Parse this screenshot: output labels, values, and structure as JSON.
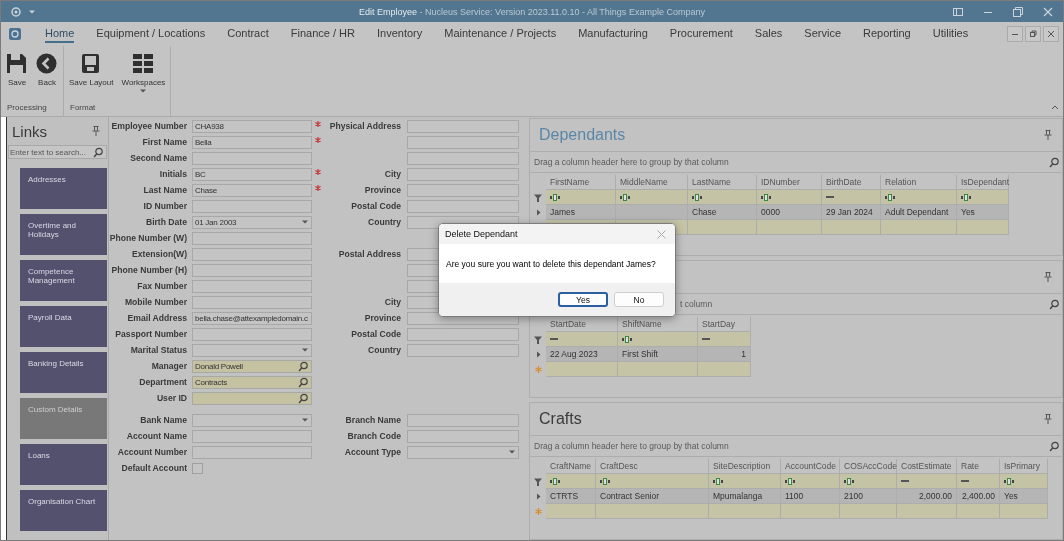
{
  "window": {
    "title": "**Edit Employee** - Nucleus Service: Version 2023.11.0.10 - All Things Example Company"
  },
  "menu": [
    {
      "label": "Home",
      "selected": true
    },
    {
      "label": "Equipment / Locations",
      "selected": false
    },
    {
      "label": "Contract",
      "selected": false
    },
    {
      "label": "Finance / HR",
      "selected": false
    },
    {
      "label": "Inventory",
      "selected": false
    },
    {
      "label": "Maintenance / Projects",
      "selected": false
    },
    {
      "label": "Manufacturing",
      "selected": false
    },
    {
      "label": "Procurement",
      "selected": false
    },
    {
      "label": "Sales",
      "selected": false
    },
    {
      "label": "Service",
      "selected": false
    },
    {
      "label": "Reporting",
      "selected": false
    },
    {
      "label": "Utilities",
      "selected": false
    }
  ],
  "ribbon": [
    {
      "label": "Processing",
      "buttons": [
        {
          "label": "Save"
        },
        {
          "label": "Back"
        }
      ]
    },
    {
      "label": "Format",
      "buttons": [
        {
          "label": "Save Layout"
        },
        {
          "label": "Workspaces",
          "dropdown": true
        }
      ]
    }
  ],
  "links": {
    "title": "Links",
    "search": {
      "placeholder": "Enter text to search..."
    },
    "items": [
      {
        "label": "Addresses",
        "disabled": false
      },
      {
        "label": "Overtime and Holidays",
        "disabled": false
      },
      {
        "label": "Competence Management",
        "disabled": false
      },
      {
        "label": "Payroll Data",
        "disabled": false
      },
      {
        "label": "Banking Details",
        "disabled": false
      },
      {
        "label": "Custom Details",
        "disabled": true
      },
      {
        "label": "Loans",
        "disabled": false
      },
      {
        "label": "Organisation Chart",
        "disabled": false
      }
    ]
  },
  "form": {
    "personal": [
      {
        "label": "Employee Number",
        "kind": "text",
        "value": "CHA938",
        "required": true
      },
      {
        "label": "First Name",
        "kind": "text",
        "value": "Bella",
        "required": true
      },
      {
        "label": "Second Name",
        "kind": "text",
        "required": false
      },
      {
        "label": "Initials",
        "kind": "text",
        "value": "BC",
        "required": true
      },
      {
        "label": "Last Name",
        "kind": "text",
        "value": "Chase",
        "required": true
      },
      {
        "label": "ID Number",
        "kind": "text",
        "required": false
      },
      {
        "label": "Birth Date",
        "kind": "dropdown",
        "value": "01 Jan 2003",
        "required": false
      },
      {
        "label": "Phone Number (W)",
        "kind": "text",
        "required": false
      },
      {
        "label": "Extension(W)",
        "kind": "text",
        "required": false
      },
      {
        "label": "Phone Number (H)",
        "kind": "text",
        "required": false
      },
      {
        "label": "Fax Number",
        "kind": "text",
        "required": false
      },
      {
        "label": "Mobile Number",
        "kind": "text",
        "required": false
      },
      {
        "label": "Email Address",
        "kind": "text",
        "value": "bella.chase@attexampledomain.c",
        "required": false
      },
      {
        "label": "Passport Number",
        "kind": "text",
        "required": false
      },
      {
        "label": "Marital Status",
        "kind": "dropdown",
        "required": false
      },
      {
        "label": "Manager",
        "kind": "lookup",
        "value": "Donald Powell",
        "required": false
      },
      {
        "label": "Department",
        "kind": "lookup",
        "value": "Contracts",
        "required": false
      },
      {
        "label": "User ID",
        "kind": "lookup",
        "required": false
      }
    ],
    "physical_address": [
      {
        "label": "Physical Address",
        "kind": "text"
      },
      {
        "kind": "text"
      },
      {
        "kind": "text"
      },
      {
        "label": "City",
        "kind": "text"
      },
      {
        "label": "Province",
        "kind": "text"
      },
      {
        "label": "Postal Code",
        "kind": "text"
      },
      {
        "label": "Country",
        "kind": "text"
      }
    ],
    "postal_address": [
      {
        "label": "Postal Address",
        "kind": "text"
      },
      {
        "kind": "text"
      },
      {
        "kind": "text"
      },
      {
        "label": "City",
        "kind": "text"
      },
      {
        "label": "Province",
        "kind": "text"
      },
      {
        "label": "Postal Code",
        "kind": "text"
      },
      {
        "label": "Country",
        "kind": "text"
      }
    ],
    "banking": [
      {
        "label": "Bank Name",
        "kind": "dropdown"
      },
      {
        "label": "Account Name",
        "kind": "text"
      },
      {
        "label": "Account Number",
        "kind": "text"
      },
      {
        "label": "Default Account",
        "kind": "checkbox",
        "checked": false
      }
    ],
    "branch": [
      {
        "label": "Branch Name",
        "kind": "text"
      },
      {
        "label": "Branch Code",
        "kind": "text"
      },
      {
        "label": "Account Type",
        "kind": "dropdown"
      }
    ]
  },
  "panels": [
    {
      "title": "Dependants",
      "group_hint": "Drag a column header here to group by that column",
      "new_row": true,
      "columns": [
        {
          "name": "FirstName",
          "kind": "text"
        },
        {
          "name": "MiddleName",
          "kind": "text"
        },
        {
          "name": "LastName",
          "kind": "text"
        },
        {
          "name": "IDNumber",
          "kind": "text"
        },
        {
          "name": "BirthDate",
          "kind": "date"
        },
        {
          "name": "Relation",
          "kind": "text"
        },
        {
          "name": "IsDependant",
          "kind": "text"
        }
      ],
      "rows": [
        [
          "James",
          null,
          "Chase",
          "0000",
          "29 Jan 2024",
          "Adult Dependant",
          "Yes"
        ]
      ]
    },
    {
      "group_hint": "t column",
      "new_row": true,
      "columns": [
        {
          "name": "StartDate",
          "kind": "date"
        },
        {
          "name": "ShiftName",
          "kind": "text"
        },
        {
          "name": "StartDay",
          "kind": "number"
        }
      ],
      "rows": [
        [
          "22 Aug 2023",
          "First Shift",
          "1"
        ]
      ]
    },
    {
      "title": "Crafts",
      "group_hint": "Drag a column header here to group by that column",
      "new_row": true,
      "columns": [
        {
          "name": "CraftName",
          "kind": "text"
        },
        {
          "name": "CraftDesc",
          "kind": "text"
        },
        {
          "name": "SiteDescription",
          "kind": "text"
        },
        {
          "name": "AccountCode",
          "kind": "text"
        },
        {
          "name": "COSAccCode",
          "kind": "text"
        },
        {
          "name": "CostEstimate",
          "kind": "number"
        },
        {
          "name": "Rate",
          "kind": "number"
        },
        {
          "name": "IsPrimary",
          "kind": "text"
        }
      ],
      "rows": [
        [
          "CTRTS",
          "Contract Senior",
          "Mpumalanga",
          "1100",
          "2100",
          "2,000.00",
          "2,400.00",
          "Yes"
        ]
      ]
    }
  ],
  "dialog": {
    "title": "Delete Dependant",
    "message": "Are you sure you want to delete this dependant James?",
    "buttons": [
      {
        "label": "Yes",
        "default": true
      },
      {
        "label": "No",
        "default": false
      }
    ]
  }
}
